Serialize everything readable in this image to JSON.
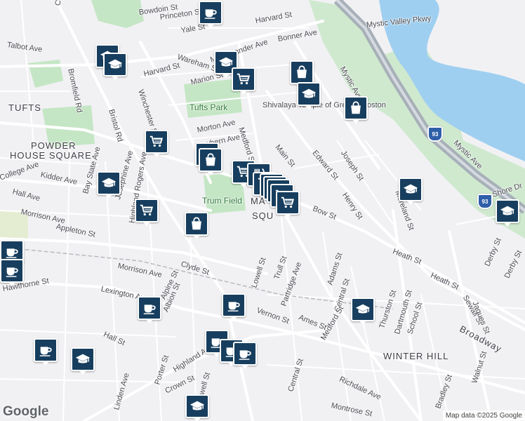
{
  "colors": {
    "water": "#9fcff0",
    "park": "#c5e6c5",
    "road": "#ffffff",
    "highway": "#a7afb8",
    "pin": "#173e5e"
  },
  "map": {
    "google_logo": "Google",
    "attribution": "Map data ©2025 Google",
    "labels": [
      {
        "text": "Bowdoin St"
      },
      {
        "text": "Princeton St"
      },
      {
        "text": "Yale St"
      },
      {
        "text": "Harvard St"
      },
      {
        "text": "Mystic Valley Pkwy"
      },
      {
        "text": "Talbot Ave"
      },
      {
        "text": "College Ave"
      },
      {
        "text": "M. Alexander Ave"
      },
      {
        "text": "Bonner Ave"
      },
      {
        "text": "Harvard St"
      },
      {
        "text": "Wareham St"
      },
      {
        "text": "Marion St"
      },
      {
        "text": "Bromfield Rd"
      },
      {
        "text": "TUFTS"
      },
      {
        "text": "Tufts Park"
      },
      {
        "text": "Shivalaya Temple of Greater Boston"
      },
      {
        "text": "Mystic Ave"
      },
      {
        "text": "Bristol Rd"
      },
      {
        "text": "Winchester St"
      },
      {
        "text": "Morton Ave"
      },
      {
        "text": "Medford St"
      },
      {
        "text": "Newbern Ave"
      },
      {
        "text": "Main St"
      },
      {
        "text": "Edward St"
      },
      {
        "text": "Joseph St"
      },
      {
        "text": "Mystic Ave"
      },
      {
        "text": "POWDER"
      },
      {
        "text": "HOUSE SQUARE"
      },
      {
        "text": "Kidder Ave"
      },
      {
        "text": "College Ave"
      },
      {
        "text": "Hall Ave"
      },
      {
        "text": "Bay State Ave"
      },
      {
        "text": "Josephine Ave"
      },
      {
        "text": "Highland Rogers Ave"
      },
      {
        "text": "Trum Field"
      },
      {
        "text": "MA"
      },
      {
        "text": "SQU"
      },
      {
        "text": "Bow St"
      },
      {
        "text": "Henry St"
      },
      {
        "text": "Morrison Ave"
      },
      {
        "text": "Appleton St"
      },
      {
        "text": "Heath St"
      },
      {
        "text": "Clyde St"
      },
      {
        "text": "Morrison Ave"
      },
      {
        "text": "Lowell St"
      },
      {
        "text": "Trull St"
      },
      {
        "text": "Partridge Ave"
      },
      {
        "text": "Adams St"
      },
      {
        "text": "Central St"
      },
      {
        "text": "Heath St"
      },
      {
        "text": "Derby St"
      },
      {
        "text": "Lexington Ave"
      },
      {
        "text": "Hawthorne St"
      },
      {
        "text": "Vernon St"
      },
      {
        "text": "Medford St"
      },
      {
        "text": "Thurston St"
      },
      {
        "text": "Dartmouth St"
      },
      {
        "text": "School St"
      },
      {
        "text": "Sewall St"
      },
      {
        "text": "Jaques St"
      },
      {
        "text": "Ames St"
      },
      {
        "text": "Hall St"
      },
      {
        "text": "Broadway"
      },
      {
        "text": "WINTER HILL"
      },
      {
        "text": "Highland Ave"
      },
      {
        "text": "Porter St"
      },
      {
        "text": "Crown St"
      },
      {
        "text": "Lowell St"
      },
      {
        "text": "Central St"
      },
      {
        "text": "Richdale Ave"
      },
      {
        "text": "Montrose St"
      },
      {
        "text": "Walnut St"
      },
      {
        "text": "Bradley St"
      },
      {
        "text": "Linden Ave"
      },
      {
        "text": "Alpine St"
      },
      {
        "text": "Albion St"
      },
      {
        "text": "Shore Dr"
      },
      {
        "text": "Moreland St"
      },
      {
        "text": "Derby St"
      }
    ],
    "pins": [
      {
        "icon": "coffee-icon"
      },
      {
        "icon": "cart-icon"
      },
      {
        "icon": "school-icon"
      },
      {
        "icon": "school-icon"
      },
      {
        "icon": "cart-icon"
      },
      {
        "icon": "bag-icon"
      },
      {
        "icon": "school-icon"
      },
      {
        "icon": "bag-icon"
      },
      {
        "icon": "cart-icon"
      },
      {
        "icon": "bag-icon"
      },
      {
        "icon": "cart-icon"
      },
      {
        "icon": "restaurant-icon"
      },
      {
        "icon": "school-icon"
      },
      {
        "icon": "cart-icon"
      },
      {
        "icon": "restaurant-icon"
      },
      {
        "icon": "cart-icon"
      },
      {
        "icon": "cart-icon"
      },
      {
        "icon": "cart-icon"
      },
      {
        "icon": "cart-icon"
      },
      {
        "icon": "school-icon"
      },
      {
        "icon": "school-icon"
      },
      {
        "icon": "bag-icon"
      },
      {
        "icon": "cart-icon"
      },
      {
        "icon": "coffee-icon"
      },
      {
        "icon": "coffee-icon"
      },
      {
        "icon": "coffee-icon"
      },
      {
        "icon": "coffee-icon"
      },
      {
        "icon": "school-icon"
      },
      {
        "icon": "school-icon"
      },
      {
        "icon": "coffee-icon"
      },
      {
        "icon": "coffee-icon"
      },
      {
        "icon": "coffee-icon"
      },
      {
        "icon": "coffee-icon"
      },
      {
        "icon": "school-icon"
      },
      {
        "icon": "school-icon"
      }
    ],
    "shields": [
      {
        "text": "93"
      },
      {
        "text": "93"
      }
    ]
  }
}
